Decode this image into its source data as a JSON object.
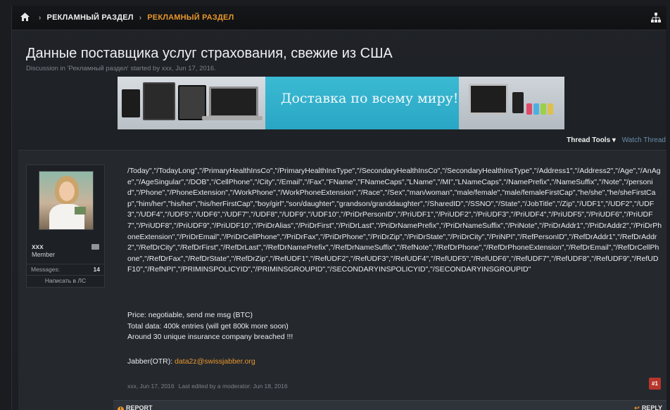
{
  "breadcrumb": {
    "home_icon": "home-icon",
    "sep": "›",
    "item1": "РЕКЛАМНЫЙ РАЗДЕЛ",
    "item2": "РЕКЛАМНЫЙ РАЗДЕЛ"
  },
  "thread": {
    "title": "Данные поставщика услуг страхования, свежие из США",
    "subtitle": "Discussion in 'Рекламный раздел' started by xxx, Jun 17, 2016."
  },
  "banner": {
    "text": "Доставка по всему миру!"
  },
  "tools": {
    "thread_tools": "Thread Tools ▾",
    "watch": "Watch Thread"
  },
  "user": {
    "name": "xxx",
    "role": "Member",
    "stat_label": "Messages:",
    "stat_value": "14",
    "pm_button": "Написать в ЛС"
  },
  "post": {
    "body": "/Today\",\"/TodayLong\",\"/PrimaryHealthInsCo\",\"/PrimaryHealthInsType\",\"/SecondaryHealthInsCo\",\"/SecondaryHealthInsType\",\"/Address1\",\"/Address2\",\"/Age\",\"/AnAge\",\"/AgeSingular\",\"/DOB\",\"/CellPhone\",\"/City\",\"/Email\",\"/Fax\",\"FName\",\"FNameCaps\",\"LName\",\"/MI\",\"LNameCaps\",\"/NamePrefix\",\"/NameSuffix\",\"/Note\",\"/personid\",\"/Phone\",\"/PhoneExtension\",\"/WorkPhone\",\"/WorkPhoneExtension\",\"/Race\",\"/Sex\",\"man/woman\",\"male/female\",\"male/femaleFirstCap\",\"he/she\",\"he/sheFirstCap\",\"him/her\",\"his/her\",\"his/herFirstCap\",\"boy/girl\",\"son/daughter\",\"grandson/granddaughter\",\"/SharedID\",\"/SSNO\",\"/State\",\"/JobTitle\",\"/Zip\",\"/UDF1\",\"/UDF2\",\"/UDF3\",\"/UDF4\",\"/UDF5\",\"/UDF6\",\"/UDF7\",\"/UDF8\",\"/UDF9\",\"/UDF10\",\"/PriDrPersonID\",\"/PriUDF1\",\"/PriUDF2\",\"/PriUDF3\",\"/PriUDF4\",\"/PriUDF5\",\"/PriUDF6\",\"/PriUDF7\",\"/PriUDF8\",\"/PriUDF9\",\"/PriUDF10\",\"/PriDrAlias\",\"/PriDrFirst\",\"/PriDrLast\",\"/PriDrNamePrefix\",\"/PriDrNameSuffix\",\"/PriNote\",\"/PriDrAddr1\",\"/PriDrAddr2\",\"/PriDrPhoneExtension\",\"/PriDrEmail\",\"/PriDrCellPhone\",\"/PriDrFax\",\"/PriDrPhone\",\"/PriDrZip\",\"/PriDrState\",\"/PriDrCity\",\"/PriNPI\",\"/RefPersonID\",\"/RefDrAddr1\",\"/RefDrAddr2\",\"/RefDrCity\",\"/RefDrFirst\",\"/RefDrLast\",\"/RefDrNamePrefix\",\"/RefDrNameSuffix\",\"/RefNote\",\"/RefDrPhone\",\"/RefDrPhoneExtension\",\"/RefDrEmail\",\"/RefDrCellPhone\",\"/RefDrFax\",\"/RefDrState\",\"/RefDrZip\",\"/RefUDF1\",\"/RefUDF2\",\"/RefUDF3\",\"/RefUDF4\",\"/RefUDF5\",\"/RefUDF6\",\"/RefUDF7\",\"/RefUDF8\",\"/RefUDF9\",\"/RefUDF10\",\"/RefNPI\",\"/PRIMINSPOLICYID\",\"/PRIMINSGROUPID\",\"/SECONDARYINSPOLICYID\",\"/SECONDARYINSGROUPID\"",
    "price": "Price: negotiable, send me msg (BTC)",
    "total": "Total data: 400k entries (will get 800k more soon)",
    "around": "Around 30 unique insurance company breached !!!",
    "jabber_label": "Jabber(OTR): ",
    "jabber_value": "data2z@swissjabber.org",
    "meta": "xxx, Jun 17, 2016",
    "edited": "Last edited by a moderator: Jun 18, 2016",
    "permalink": "#1"
  },
  "actions": {
    "report": "REPORT",
    "reply": "REPLY"
  }
}
